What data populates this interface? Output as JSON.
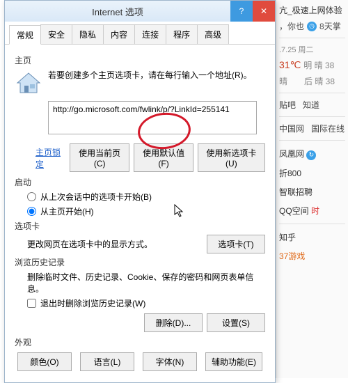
{
  "dialog": {
    "title": "Internet 选项",
    "tabs": [
      "常规",
      "安全",
      "隐私",
      "内容",
      "连接",
      "程序",
      "高级"
    ],
    "activeTab": 0,
    "homepage": {
      "label": "主页",
      "instruction": "若要创建多个主页选项卡，请在每行输入一个地址(R)。",
      "url": "http://go.microsoft.com/fwlink/p/?LinkId=255141",
      "lockLink": "主页锁定",
      "useCurrentBtn": "使用当前页(C)",
      "useDefaultBtn": "使用默认值(F)",
      "useNewTabBtn": "使用新选项卡(U)"
    },
    "startup": {
      "label": "启动",
      "opt1": "从上次会话中的选项卡开始(B)",
      "opt2": "从主页开始(H)"
    },
    "tabsSect": {
      "label": "选项卡",
      "text": "更改网页在选项卡中的显示方式。",
      "btn": "选项卡(T)"
    },
    "history": {
      "label": "浏览历史记录",
      "text": "删除临时文件、历史记录、Cookie、保存的密码和网页表单信息。",
      "check": "退出时删除浏览历史记录(W)",
      "deleteBtn": "删除(D)...",
      "settingsBtn": "设置(S)"
    },
    "appearance": {
      "label": "外观",
      "colorBtn": "颜色(O)",
      "langBtn": "语言(L)",
      "fontBtn": "字体(N)",
      "accessBtn": "辅助功能(E)"
    }
  },
  "bg": {
    "tabTitle": "亢_极速上网体验",
    "userLine": "，你也",
    "badge": "8天掌",
    "date": ".7.25 周二",
    "temp": "31℃",
    "w1": "明 晴 38",
    "w2": "晴",
    "w3": "后 晴 38",
    "nav1": "贴吧",
    "nav2": "知道",
    "nav3": "中国网",
    "nav4": "国际在线",
    "links": [
      "凤凰网",
      "折800",
      "智联招聘",
      "QQ空间",
      "知乎",
      "37游戏"
    ]
  }
}
